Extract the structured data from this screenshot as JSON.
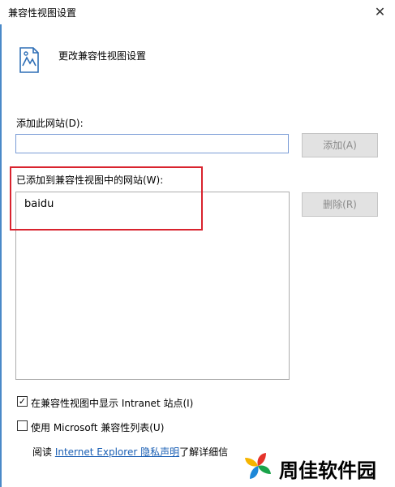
{
  "dialog": {
    "title": "兼容性视图设置",
    "close_glyph": "✕",
    "header_text": "更改兼容性视图设置"
  },
  "add_section": {
    "label": "添加此网站(D):",
    "input_value": "",
    "add_button": "添加(A)"
  },
  "list_section": {
    "label": "已添加到兼容性视图中的网站(W):",
    "items": [
      "baidu"
    ],
    "remove_button": "删除(R)"
  },
  "options": {
    "intranet": {
      "label": "在兼容性视图中显示 Intranet 站点(I)",
      "checked": true
    },
    "ms_list": {
      "label": "使用 Microsoft 兼容性列表(U)",
      "checked": false
    }
  },
  "privacy": {
    "prefix": "阅读 ",
    "link": "Internet Explorer 隐私声明",
    "suffix": "了解详细信"
  },
  "watermark": {
    "text": "周佳软件园"
  },
  "colors": {
    "highlight": "#d9232e",
    "link": "#1a5fb4",
    "input_border": "#7a9cd6",
    "disabled_button_bg": "#e2e2e2"
  }
}
